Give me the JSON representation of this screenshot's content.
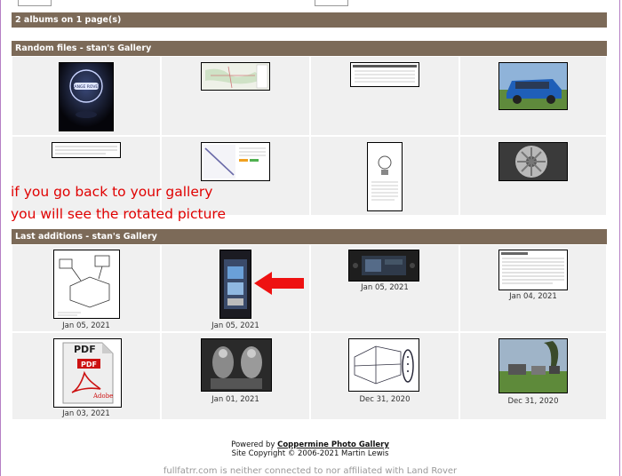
{
  "albums_summary": "2 albums on 1 page(s)",
  "random_section": {
    "title": "Random files - stan's Gallery"
  },
  "last_section": {
    "title": "Last additions - stan's Gallery",
    "dates": [
      "Jan 05, 2021",
      "Jan 05, 2021",
      "Jan 05, 2021",
      "Jan 04, 2021",
      "Jan 03, 2021",
      "Jan 01, 2021",
      "Dec 31, 2020",
      "Dec 31, 2020"
    ]
  },
  "annotation": {
    "line1": "if you go back to your gallery",
    "line2": "you will see the rotated picture",
    "color": "#e00000"
  },
  "pdf_icon": {
    "label_top": "PDF",
    "label_badge": "PDF",
    "label_brand": "Adobe"
  },
  "logo_badge": "RANGE ROVER",
  "footer": {
    "powered_by": "Powered by",
    "link_text": "Coppermine Photo Gallery",
    "copyright": "Site Copyright © 2006-2021 Martin Lewis"
  },
  "disclaimer": "fullfatrr.com is neither connected to nor affiliated with Land Rover",
  "colors": {
    "header_bar": "#7c6a58",
    "cell_bg": "#f0f0f0",
    "frame_border": "#b57fc4"
  }
}
